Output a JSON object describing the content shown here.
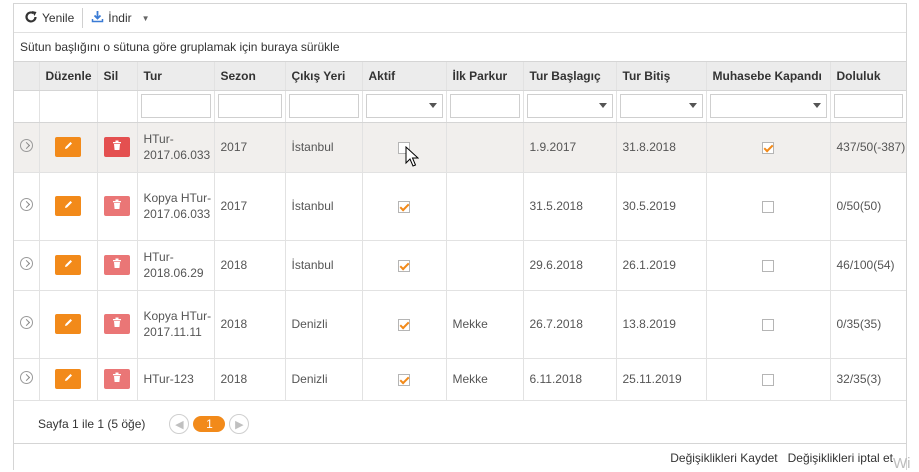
{
  "toolbar": {
    "refresh_label": "Yenile",
    "download_label": "İndir"
  },
  "group_area": {
    "hint": "Sütun başlığını o sütuna göre gruplamak için buraya sürükle"
  },
  "columns": {
    "edit": "Düzenle",
    "delete": "Sil",
    "tour": "Tur",
    "season": "Sezon",
    "departure": "Çıkış Yeri",
    "active": "Aktif",
    "first_route": "İlk Parkur",
    "start": "Tur Başlagıç",
    "end": "Tur Bitiş",
    "accounting": "Muhasebe Kapandı",
    "occupancy": "Doluluk"
  },
  "rows": [
    {
      "tour": "HTur-2017.06.033",
      "season": "2017",
      "departure": "İstanbul",
      "active": false,
      "first_route": "",
      "start": "1.9.2017",
      "end": "31.8.2018",
      "accounting": true,
      "occupancy": "437/50(-387)"
    },
    {
      "tour": "Kopya HTur-2017.06.033",
      "season": "2017",
      "departure": "İstanbul",
      "active": true,
      "first_route": "",
      "start": "31.5.2018",
      "end": "30.5.2019",
      "accounting": false,
      "occupancy": "0/50(50)"
    },
    {
      "tour": "HTur-2018.06.29",
      "season": "2018",
      "departure": "İstanbul",
      "active": true,
      "first_route": "",
      "start": "29.6.2018",
      "end": "26.1.2019",
      "accounting": false,
      "occupancy": "46/100(54)"
    },
    {
      "tour": "Kopya HTur-2017.11.11",
      "season": "2018",
      "departure": "Denizli",
      "active": true,
      "first_route": "Mekke",
      "start": "26.7.2018",
      "end": "13.8.2019",
      "accounting": false,
      "occupancy": "0/35(35)"
    },
    {
      "tour": "HTur-123",
      "season": "2018",
      "departure": "Denizli",
      "active": true,
      "first_route": "Mekke",
      "start": "6.11.2018",
      "end": "25.11.2019",
      "accounting": false,
      "occupancy": "32/35(3)"
    }
  ],
  "pager": {
    "info": "Sayfa 1 ile 1 (5 öğe)",
    "current_page": "1"
  },
  "footer": {
    "save_label": "Değişiklikleri Kaydet",
    "cancel_label": "Değişiklikleri iptal et"
  },
  "watermark": "Wi",
  "colors": {
    "accent": "#f28a1a",
    "delete": "#e45050",
    "header_bg": "#ececec",
    "hover_row": "#f1efed"
  }
}
